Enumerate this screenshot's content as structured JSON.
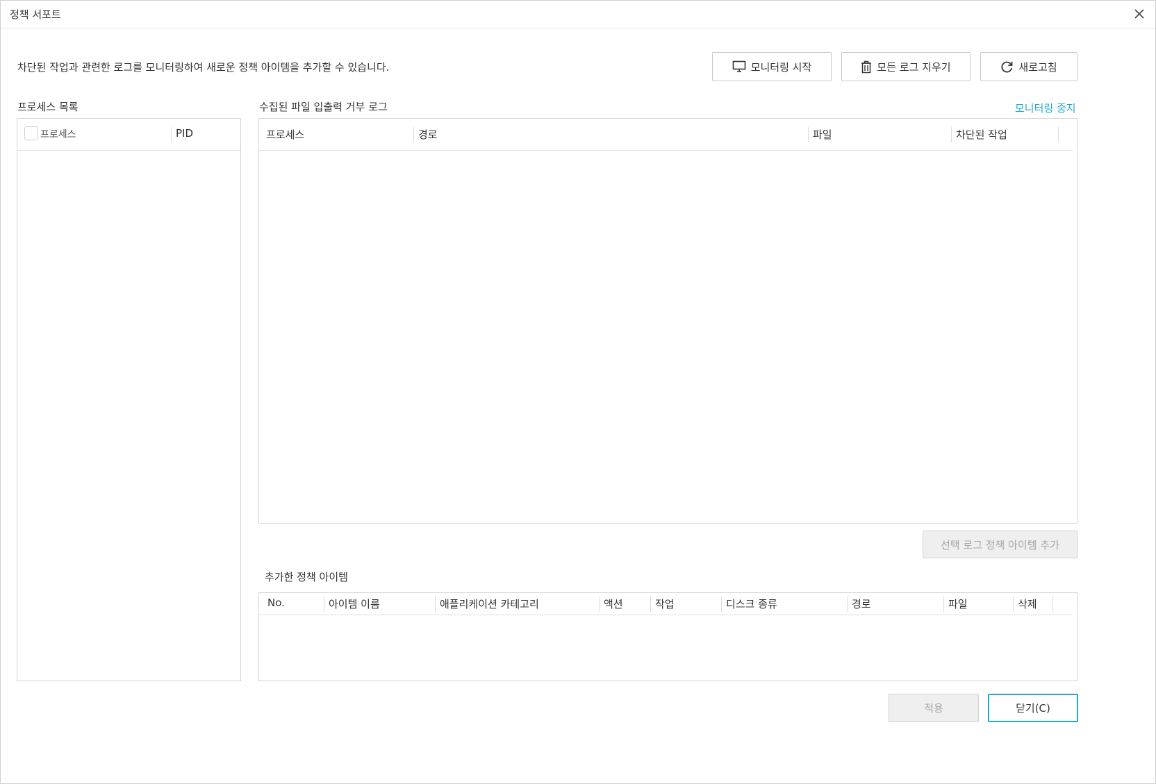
{
  "window": {
    "title": "정책 서포트"
  },
  "description": "차단된 작업과 관련한 로그를 모니터링하여 새로운 정책 아이템을 추가할 수 있습니다.",
  "toolbar": {
    "start_monitoring": "모니터링 시작",
    "clear_logs": "모든 로그 지우기",
    "refresh": "새로고침"
  },
  "process_list": {
    "label": "프로세스 목록",
    "columns": [
      "프로세스",
      "PID"
    ],
    "rows": []
  },
  "log_table": {
    "label": "수집된 파일 입출력 거부 로그",
    "stop_link": "모니터링 중지",
    "columns": [
      "프로세스",
      "경로",
      "파일",
      "차단된 작업"
    ],
    "rows": []
  },
  "add_selected_button": "선택 로그 정책 아이템 추가",
  "policy_items": {
    "label": "추가한 정책 아이템",
    "columns": [
      "No.",
      "아이템 이름",
      "애플리케이션 카테고리",
      "액션",
      "작업",
      "디스크 종류",
      "경로",
      "파일",
      "삭제"
    ],
    "rows": []
  },
  "footer": {
    "apply": "적용",
    "close": "닫기(C)"
  },
  "colors": {
    "accent": "#1eaad2",
    "border": "#d4d4d4",
    "disabled_bg": "#efefef",
    "disabled_text": "#a5a5a5"
  },
  "icons": {
    "start_monitoring": "monitor-icon",
    "clear_logs": "trash-icon",
    "refresh": "refresh-icon",
    "close": "close-icon"
  }
}
